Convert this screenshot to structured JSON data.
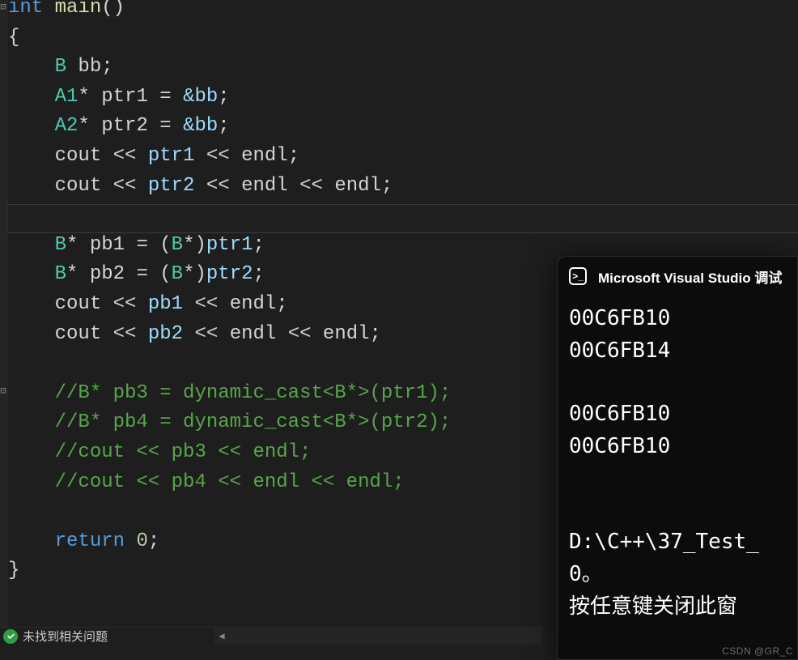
{
  "code": {
    "ret_type": "int",
    "fn_name": "main",
    "parens": "()",
    "lbrace": "{",
    "rbrace": "}",
    "decl_B": "B",
    "decl_bb": "bb",
    "semi": ";",
    "A1": "A1",
    "A2": "A2",
    "star": "*",
    "ptr1": "ptr1",
    "ptr2": "ptr2",
    "eq": "=",
    "amp_bb": "&bb",
    "cout": "cout",
    "lsh": "<<",
    "endl": "endl",
    "B": "B",
    "pb1": "pb1",
    "pb2": "pb2",
    "cast_open": "(",
    "cast_B": "B",
    "cast_star": "*",
    "cast_close": ")",
    "comment1": "//B* pb3 = dynamic_cast<B*>(ptr1);",
    "comment2": "//B* pb4 = dynamic_cast<B*>(ptr2);",
    "comment3": "//cout << pb3 << endl;",
    "comment4": "//cout << pb4 << endl << endl;",
    "return_kw": "return",
    "zero": "0"
  },
  "status": {
    "text": "未找到相关问题"
  },
  "console": {
    "title": "Microsoft Visual Studio 调试",
    "lines": {
      "l1": "00C6FB10",
      "l2": "00C6FB14",
      "l3": "00C6FB10",
      "l4": "00C6FB10",
      "l5": "D:\\C++\\37_Test_",
      "l6": "0。",
      "l7": "按任意键关闭此窗"
    }
  },
  "watermark": "CSDN @GR_C"
}
